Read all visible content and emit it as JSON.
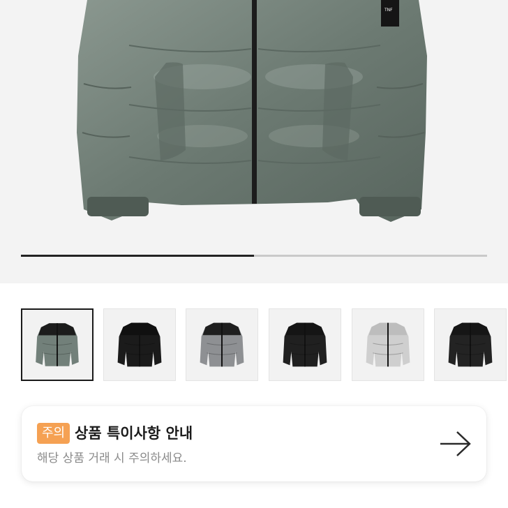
{
  "product": {
    "image_label": "green-puffer-jacket",
    "brand_color": "#6f7e73",
    "gallery_progress": 0.5
  },
  "thumbnails": [
    {
      "color_name": "green-grey",
      "body": "#72807a",
      "yoke": "#1c1c1c",
      "active": true
    },
    {
      "color_name": "black-gloss",
      "body": "#1b1b1b",
      "yoke": "#101010",
      "active": false
    },
    {
      "color_name": "grey",
      "body": "#8e9093",
      "yoke": "#1f1f1f",
      "active": false
    },
    {
      "color_name": "black",
      "body": "#202020",
      "yoke": "#151515",
      "active": false
    },
    {
      "color_name": "white-camo",
      "body": "#cfcfcf",
      "yoke": "#bdbdbd",
      "active": false
    },
    {
      "color_name": "black-matte",
      "body": "#232323",
      "yoke": "#161616",
      "active": false
    }
  ],
  "notice": {
    "badge": "주의",
    "title": "상품 특이사항 안내",
    "subtitle": "해당 상품 거래 시 주의하세요.",
    "arrow_icon": "arrow-right-icon",
    "badge_color": "#f5a153"
  }
}
